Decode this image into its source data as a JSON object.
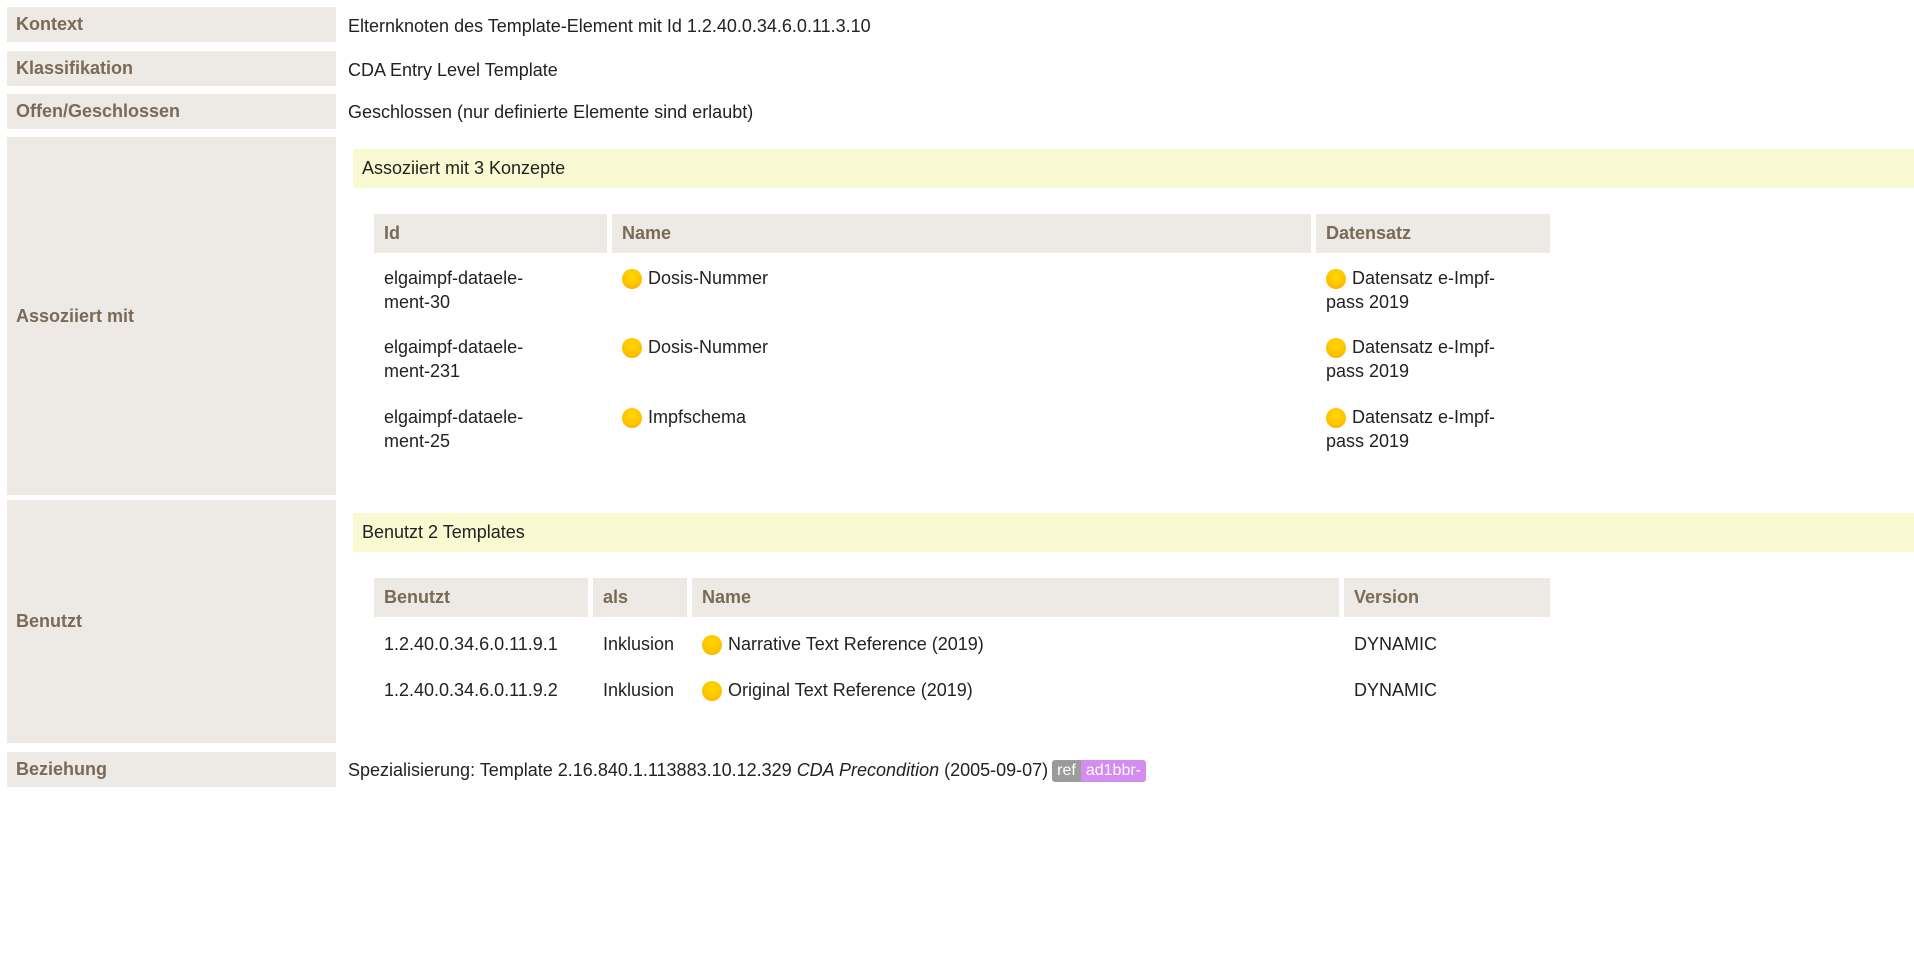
{
  "rows": {
    "kontext": {
      "label": "Kontext",
      "value": "Elternknoten des Template-Element mit Id 1.2.40.0.34.6.0.11.3.10"
    },
    "klassifikation": {
      "label": "Klassifikation",
      "value": "CDA Entry Level Template"
    },
    "offen": {
      "label": "Offen/Geschlossen",
      "value": "Geschlossen (nur definierte Elemente sind erlaubt)"
    },
    "assoziiert": {
      "label": "Assoziiert mit",
      "band": "Assoziiert mit 3 Konzepte",
      "headers": {
        "id": "Id",
        "name": "Name",
        "datensatz": "Datensatz"
      },
      "items": [
        {
          "id_line1": "elgaimpf-dataele-",
          "id_line2": "ment-30",
          "name": "Dosis-Nummer",
          "ds_line1": "Datensatz e-Impf-",
          "ds_line2": "pass 2019"
        },
        {
          "id_line1": "elgaimpf-dataele-",
          "id_line2": "ment-231",
          "name": "Dosis-Nummer",
          "ds_line1": "Datensatz e-Impf-",
          "ds_line2": "pass 2019"
        },
        {
          "id_line1": "elgaimpf-dataele-",
          "id_line2": "ment-25",
          "name": "Impfschema",
          "ds_line1": "Datensatz e-Impf-",
          "ds_line2": "pass 2019"
        }
      ]
    },
    "benutzt": {
      "label": "Benutzt",
      "band": "Benutzt 2 Templates",
      "headers": {
        "benutzt": "Benutzt",
        "als": "als",
        "name": "Name",
        "version": "Version"
      },
      "items": [
        {
          "id": "1.2.40.0.34.6.0.11.9.1",
          "als": "Inklusion",
          "name": "Narrative Text Reference (2019)",
          "version": "DYNAMIC"
        },
        {
          "id": "1.2.40.0.34.6.0.11.9.2",
          "als": "Inklusion",
          "name": "Original Text Reference (2019)",
          "version": "DYNAMIC"
        }
      ]
    },
    "beziehung": {
      "label": "Beziehung",
      "prefix": "Spezialisierung: Template 2.16.840.1.113883.10.12.329",
      "name": "CDA Precondition",
      "date": "(2005‑09‑07)",
      "tag_ref": "ref",
      "tag_id": "ad1bbr-"
    }
  },
  "colors": {
    "label_bg": "#ede9e4",
    "label_text": "#7a6a58",
    "band_bg": "#fafad2",
    "dot": "#ffc400",
    "tag_ref": "#9b9b9b",
    "tag_id": "#d48cf0"
  }
}
